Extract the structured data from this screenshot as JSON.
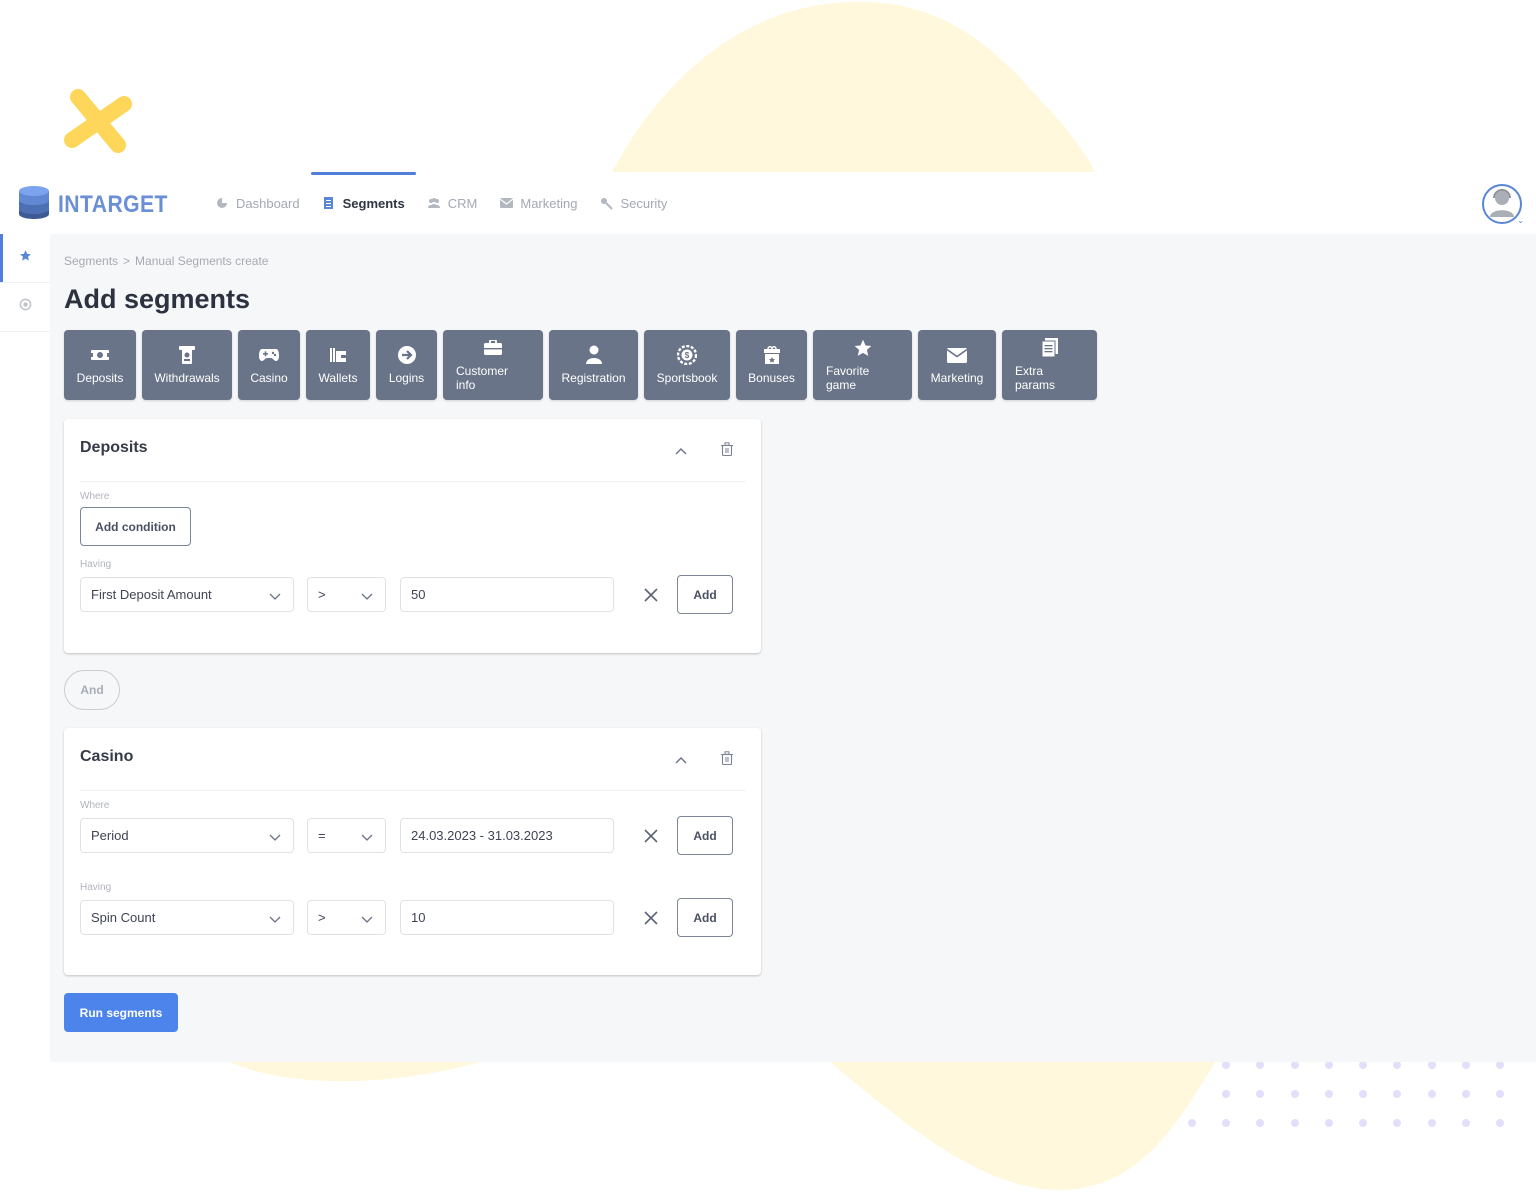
{
  "app": {
    "brand": "INTARGET"
  },
  "nav": {
    "items": [
      {
        "label": "Dashboard",
        "icon": "pie-chart-icon",
        "active": false
      },
      {
        "label": "Segments",
        "icon": "document-icon",
        "active": true
      },
      {
        "label": "CRM",
        "icon": "users-icon",
        "active": false
      },
      {
        "label": "Marketing",
        "icon": "envelope-icon",
        "active": false
      },
      {
        "label": "Security",
        "icon": "key-icon",
        "active": false
      }
    ]
  },
  "user": {
    "avatar_icon": "support-agent-icon"
  },
  "sidebar": {
    "items": [
      {
        "icon": "star-icon",
        "active": true
      },
      {
        "icon": "settings-icon",
        "active": false
      }
    ]
  },
  "breadcrumb": {
    "items": [
      "Segments",
      "Manual Segments create"
    ],
    "separator": ">"
  },
  "page": {
    "title": "Add segments"
  },
  "categories": [
    {
      "label": "Deposits",
      "icon": "money-icon"
    },
    {
      "label": "Withdrawals",
      "icon": "atm-icon"
    },
    {
      "label": "Casino",
      "icon": "gamepad-icon"
    },
    {
      "label": "Wallets",
      "icon": "wallet-icon"
    },
    {
      "label": "Logins",
      "icon": "login-arrow-icon"
    },
    {
      "label": "Customer info",
      "icon": "briefcase-icon"
    },
    {
      "label": "Registration",
      "icon": "user-icon"
    },
    {
      "label": "Sportsbook",
      "icon": "chip-icon"
    },
    {
      "label": "Bonuses",
      "icon": "gift-icon"
    },
    {
      "label": "Favorite game",
      "icon": "star-icon"
    },
    {
      "label": "Marketing",
      "icon": "envelope-icon"
    },
    {
      "label": "Extra params",
      "icon": "documents-icon"
    }
  ],
  "cards": [
    {
      "title": "Deposits",
      "where_label": "Where",
      "add_condition_label": "Add condition",
      "having_label": "Having",
      "having_rows": [
        {
          "field": "First Deposit Amount",
          "operator": ">",
          "value": "50",
          "add_label": "Add"
        }
      ]
    },
    {
      "title": "Casino",
      "where_label": "Where",
      "where_rows": [
        {
          "field": "Period",
          "operator": "=",
          "value": "24.03.2023 - 31.03.2023",
          "add_label": "Add"
        }
      ],
      "having_label": "Having",
      "having_rows": [
        {
          "field": "Spin Count",
          "operator": ">",
          "value": "10",
          "add_label": "Add"
        }
      ]
    }
  ],
  "connector": {
    "label": "And"
  },
  "actions": {
    "run_label": "Run segments"
  },
  "colors": {
    "accent": "#4d84ec",
    "brand": "#6a8fd6",
    "category_button": "#6a7488",
    "decor_yellow": "#fff8dc",
    "decor_dots": "#e3defa"
  }
}
